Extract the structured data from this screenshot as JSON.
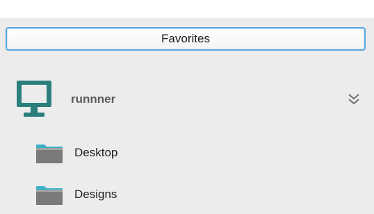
{
  "favorites": {
    "label": "Favorites"
  },
  "device": {
    "name": "runnner",
    "icon": "computer-monitor-icon",
    "expand_icon": "double-chevron-down-icon",
    "icon_color": "#2a7f7d"
  },
  "folders": [
    {
      "label": "Desktop",
      "icon": "folder-icon"
    },
    {
      "label": "Designs",
      "icon": "folder-icon"
    }
  ],
  "colors": {
    "panel_background": "#ececec",
    "favorites_border": "#5aa8e0",
    "folder_body": "#7a7a7a",
    "folder_tab": "#3bb0c8"
  }
}
